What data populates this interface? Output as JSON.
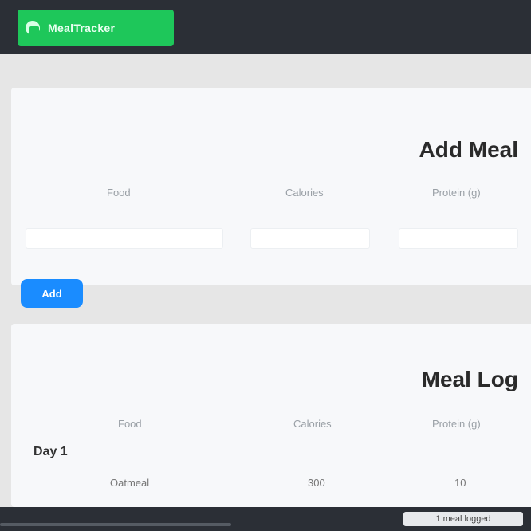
{
  "topbar": {
    "brand_label": "MealTracker",
    "brand_icon": "plate-icon",
    "brand_color": "#1ec75a",
    "bar_color": "#2b2f36"
  },
  "add_meal": {
    "title": "Add Meal",
    "columns": [
      "Food",
      "Calories",
      "Protein (g)"
    ],
    "fields": [
      {
        "value": "",
        "placeholder": ""
      },
      {
        "value": "",
        "placeholder": ""
      },
      {
        "value": "",
        "placeholder": ""
      }
    ],
    "button_label": "Add",
    "button_color": "#1a8cff"
  },
  "meal_log": {
    "title": "Meal Log",
    "columns": [
      "Food",
      "Calories",
      "Protein (g)"
    ],
    "days": [
      {
        "label": "Day 1",
        "rows": [
          {
            "food": "Oatmeal",
            "calories": "300",
            "protein": "10"
          }
        ]
      }
    ]
  },
  "status": {
    "text": "1 meal logged"
  }
}
